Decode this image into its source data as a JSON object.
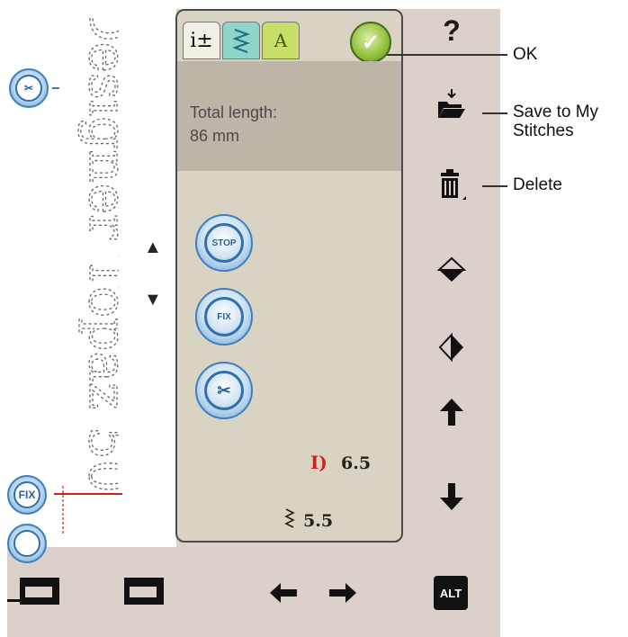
{
  "stitch_text": "Designer Topaz 50",
  "side_buttons": {
    "scissors": "✂",
    "fix": "FIX"
  },
  "nav": {
    "up": "▲",
    "down": "▼"
  },
  "tabs": {
    "info_label": "i±",
    "stitch_label": "",
    "font_label": "A"
  },
  "info": {
    "total_length_label": "Total length:",
    "total_length_value": "86 mm"
  },
  "panel_buttons": {
    "stop": "STOP",
    "fix": "FIX",
    "scissors": "✂"
  },
  "readouts": {
    "stitch_length": "6.5",
    "stitch_width": "5.5"
  },
  "right_toolbar": {
    "help": "?",
    "ok": "✓"
  },
  "bottom": {
    "alt": "ALT"
  },
  "callouts": {
    "ok": "OK",
    "save": "Save to My Stitches",
    "delete": "Delete"
  }
}
